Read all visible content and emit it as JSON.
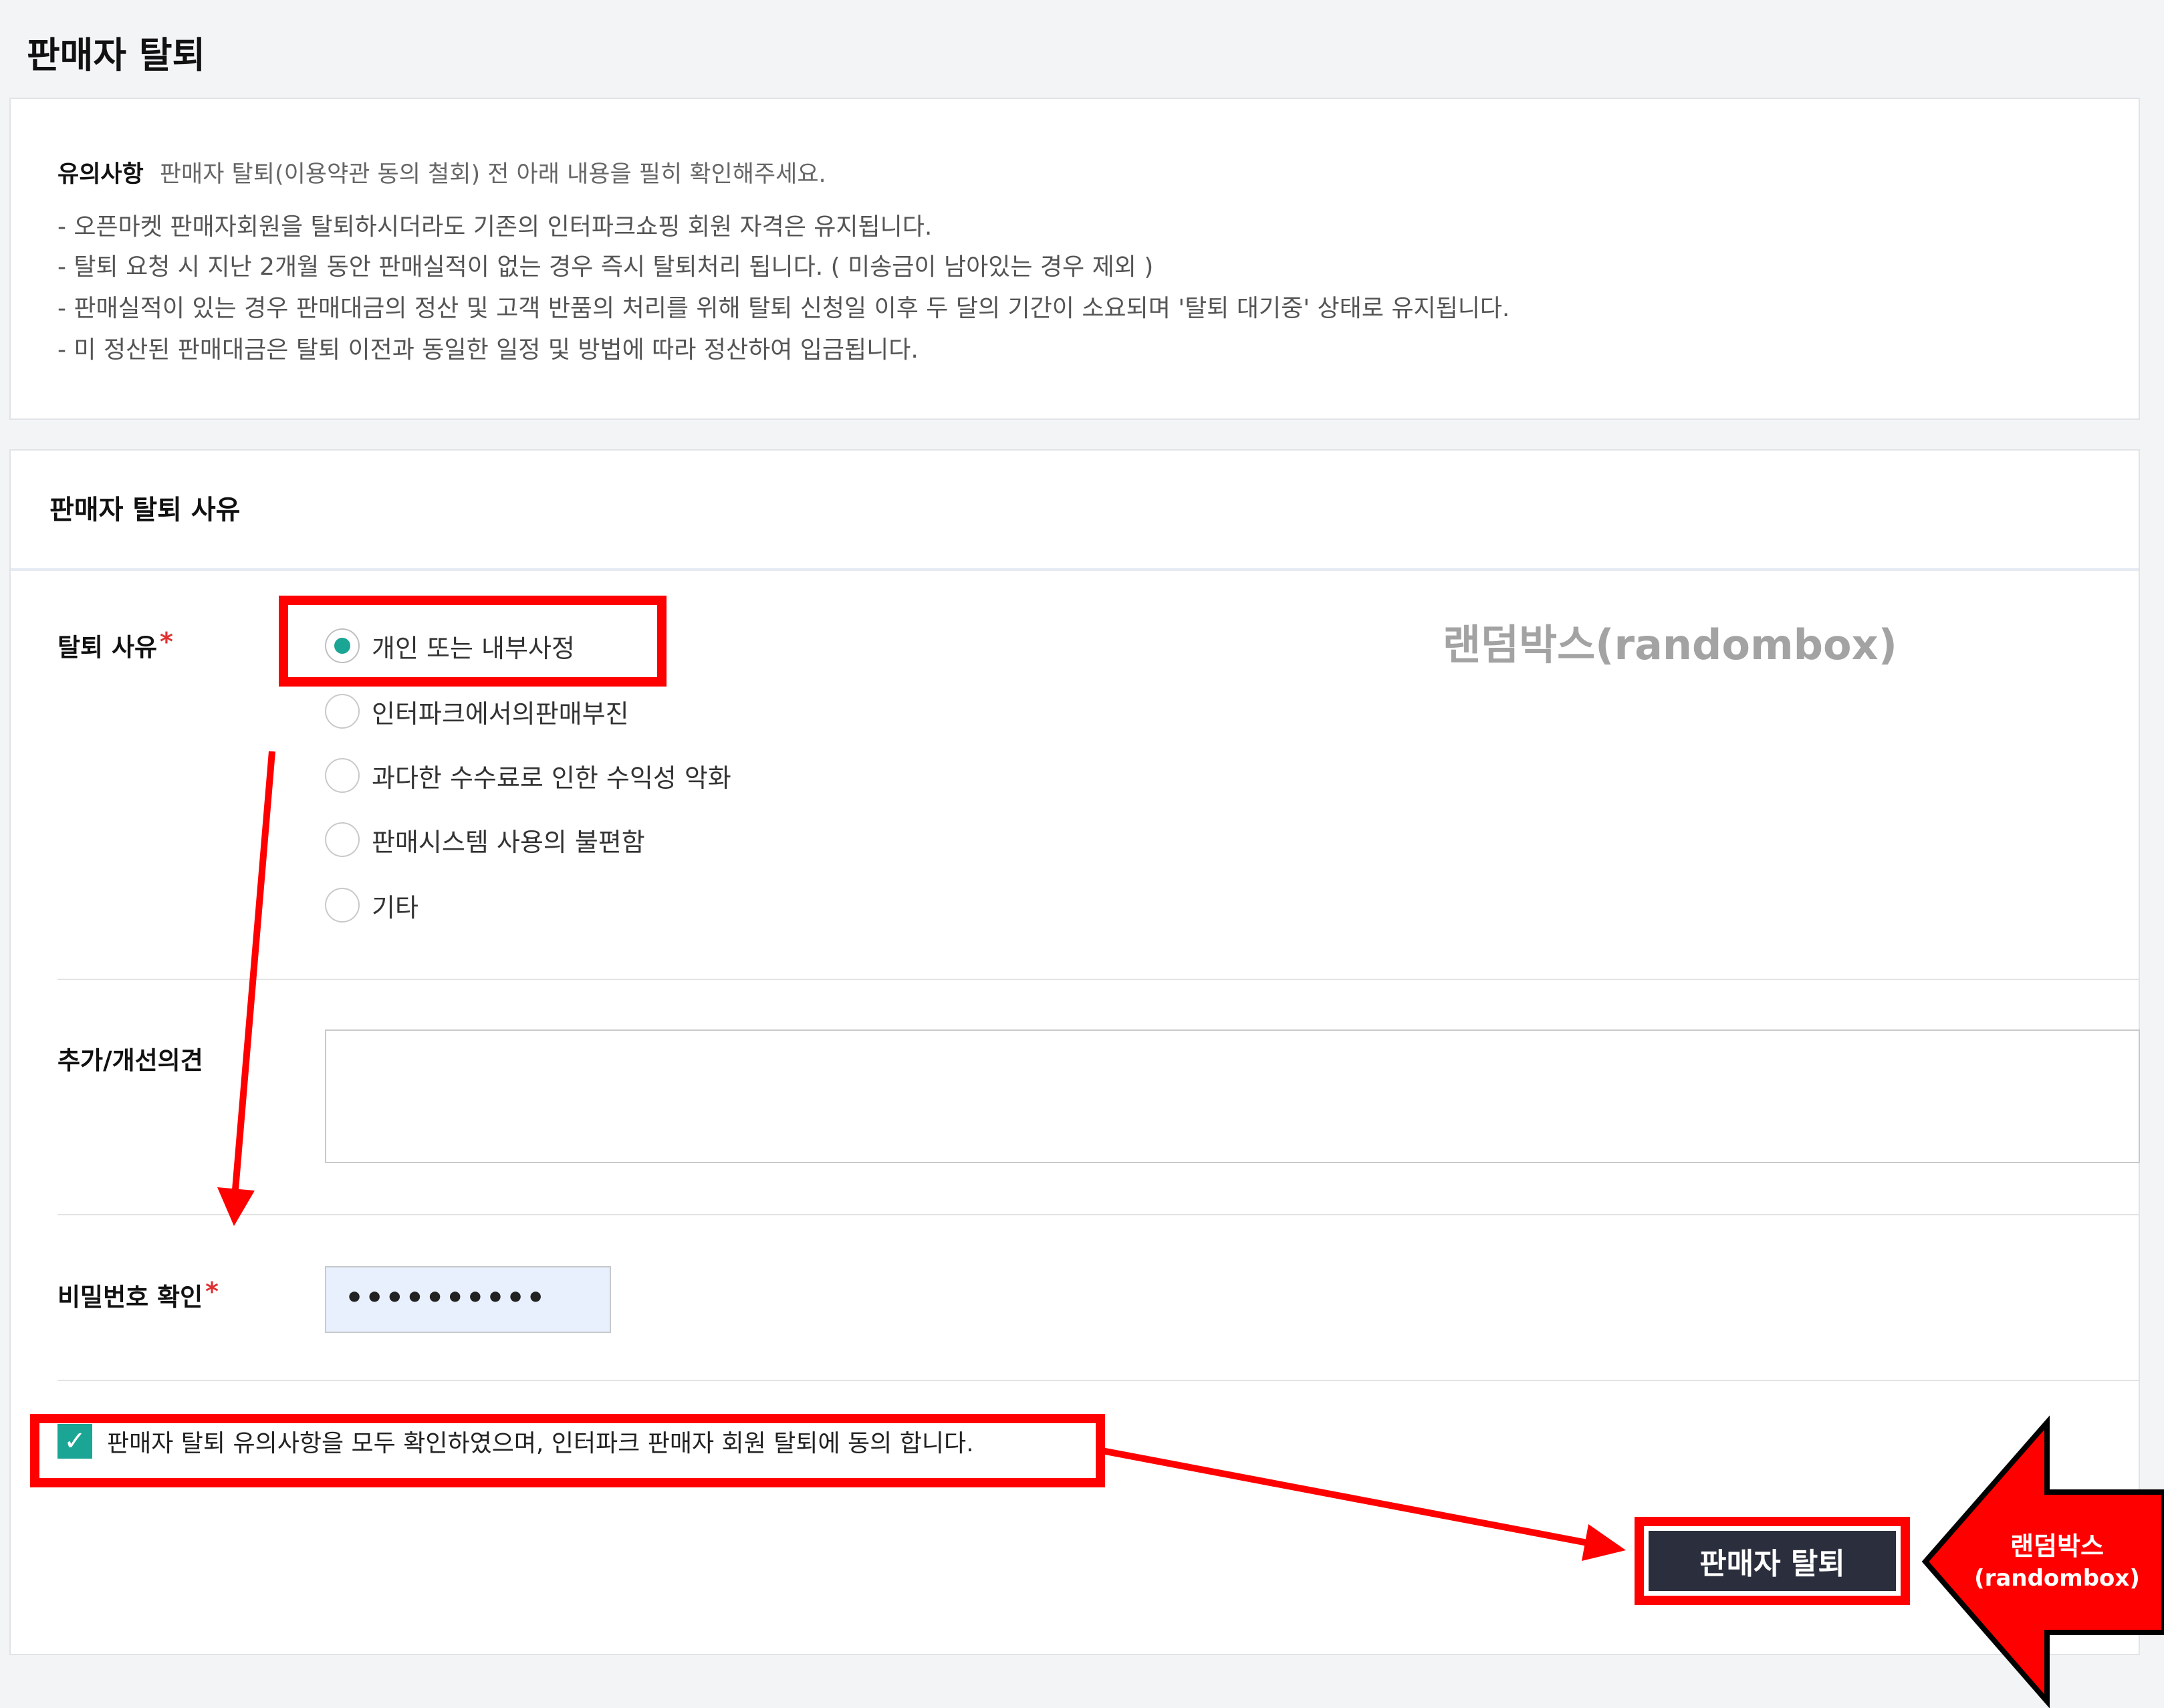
{
  "page": {
    "title": "판매자 탈퇴"
  },
  "notice": {
    "heading": "유의사항",
    "subheading": "판매자 탈퇴(이용약관 동의 철회) 전 아래 내용을 필히 확인해주세요.",
    "lines": [
      "- 오픈마켓 판매자회원을 탈퇴하시더라도 기존의 인터파크쇼핑 회원 자격은 유지됩니다.",
      "- 탈퇴 요청 시 지난 2개월 동안 판매실적이 없는 경우 즉시 탈퇴처리 됩니다. ( 미송금이 남아있는 경우 제외 )",
      "- 판매실적이 있는 경우 판매대금의 정산 및 고객 반품의 처리를 위해 탈퇴 신청일 이후 두 달의 기간이 소요되며 '탈퇴 대기중' 상태로 유지됩니다.",
      "- 미 정산된 판매대금은 탈퇴 이전과 동일한 일정 및 방법에 따라 정산하여 입금됩니다."
    ]
  },
  "form": {
    "section_title": "판매자 탈퇴 사유",
    "reason_label": "탈퇴 사유",
    "required_mark": "*",
    "reasons": [
      {
        "label": "개인 또는 내부사정",
        "selected": true
      },
      {
        "label": "인터파크에서의판매부진",
        "selected": false
      },
      {
        "label": "과다한 수수료로 인한 수익성 악화",
        "selected": false
      },
      {
        "label": "판매시스템 사용의 불편함",
        "selected": false
      },
      {
        "label": "기타",
        "selected": false
      }
    ],
    "opinion_label": "추가/개선의견",
    "opinion_value": "",
    "password_label": "비밀번호 확인",
    "password_value": "••••••••••",
    "agree_checked": true,
    "agree_label": "판매자 탈퇴 유의사항을 모두 확인하였으며, 인터파크 판매자 회원 탈퇴에 동의 합니다.",
    "submit_label": "판매자 탈퇴"
  },
  "annotations": {
    "watermark": "랜덤박스(randombox)",
    "arrow_line1": "랜덤박스",
    "arrow_line2": "(randombox)",
    "highlight_color": "#ff0000"
  },
  "colors": {
    "accent_teal": "#1aa594",
    "button_dark": "#2b2f3d",
    "required_red": "#e03131",
    "password_fill": "#e8f0fe"
  }
}
